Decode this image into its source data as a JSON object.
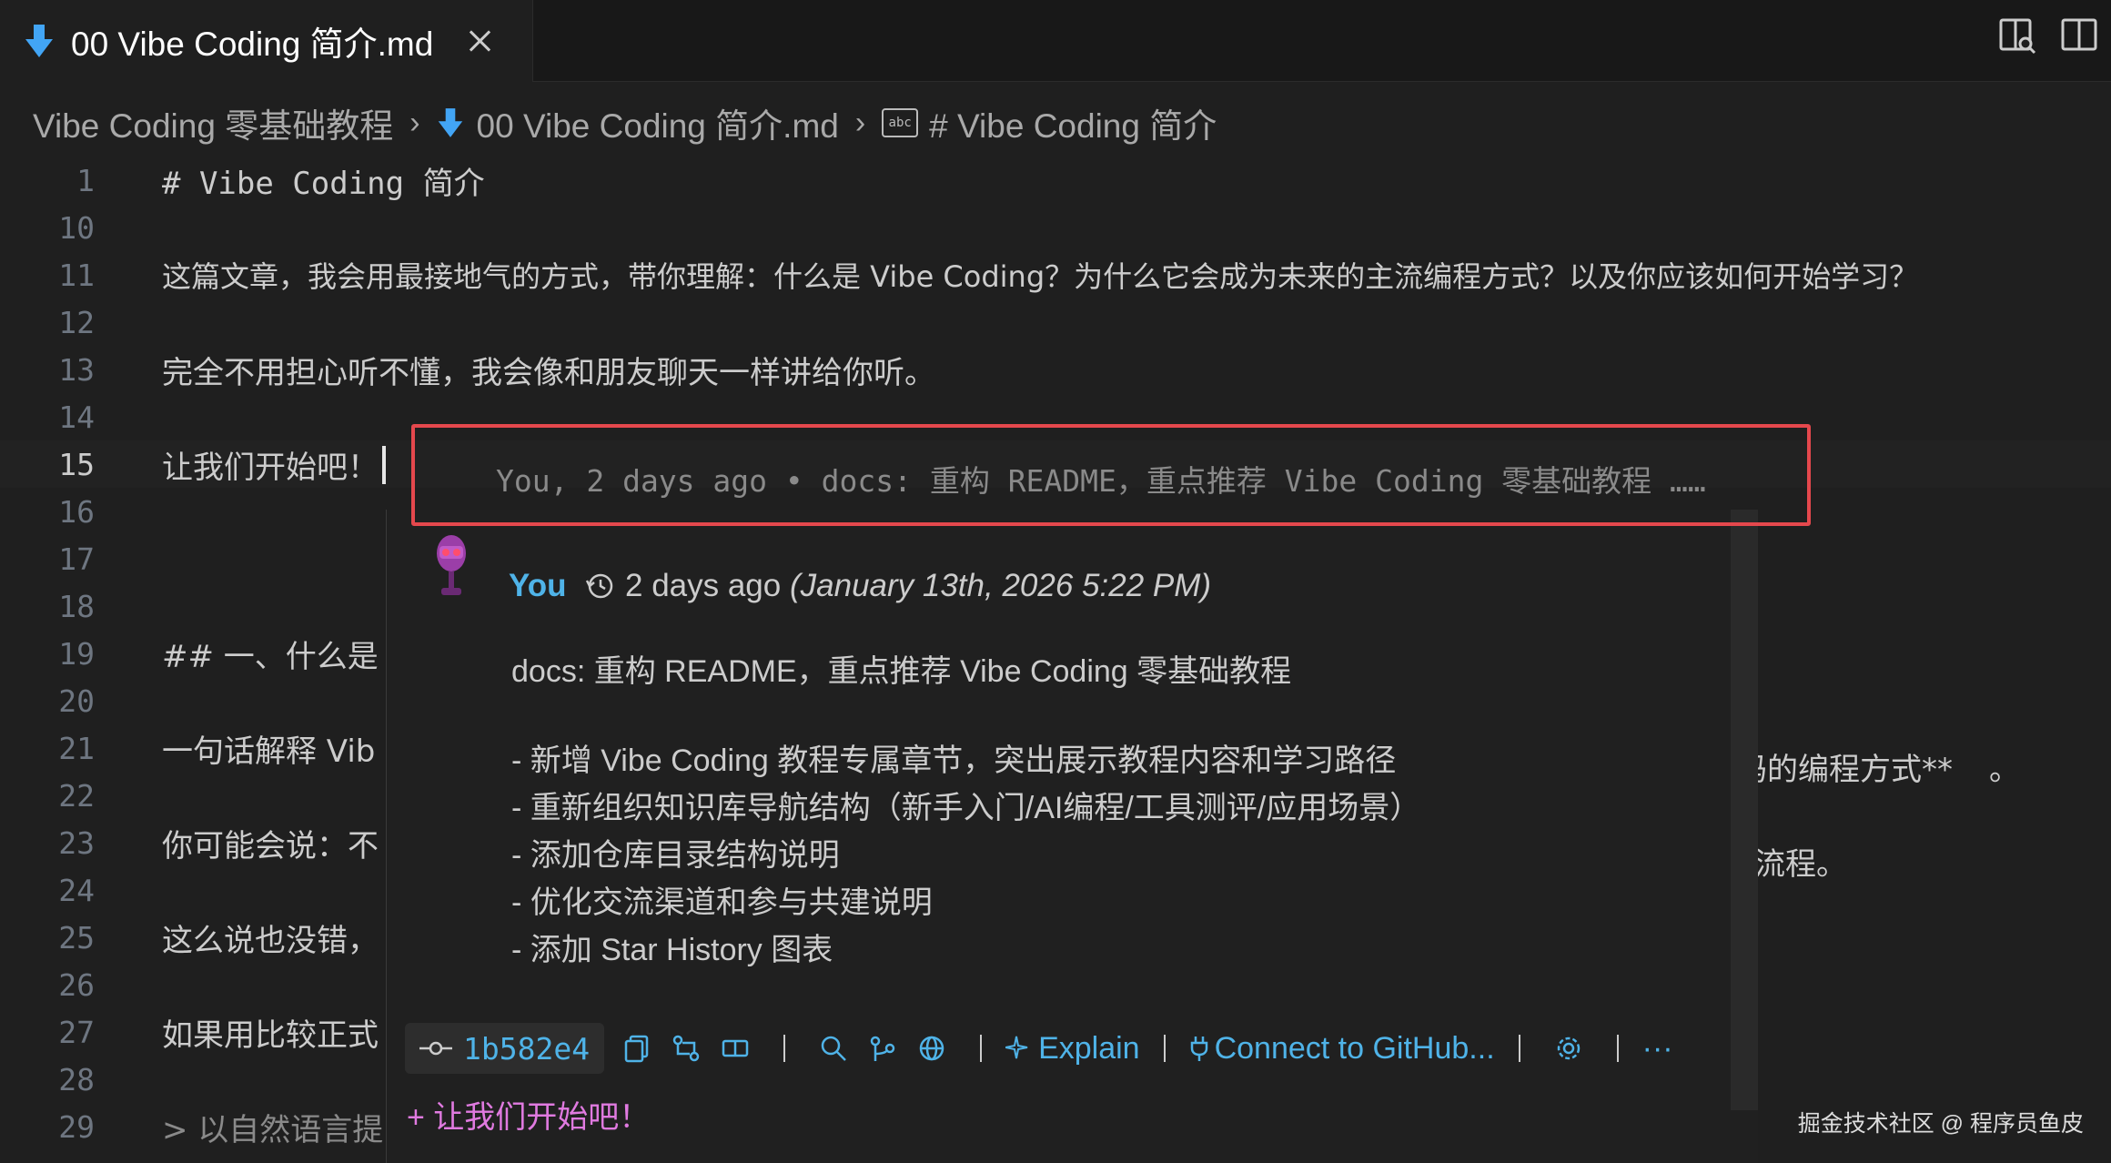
{
  "tab": {
    "title": "00 Vibe Coding 简介.md"
  },
  "breadcrumb": {
    "folder": "Vibe Coding 零基础教程",
    "file": "00 Vibe Coding 简介.md",
    "symbol": "# Vibe Coding 简介",
    "symbol_icon_text": "abc"
  },
  "lines": [
    {
      "n": "1",
      "text": "# Vibe Coding 简介"
    },
    {
      "n": "10",
      "text": ""
    },
    {
      "n": "11",
      "text": "这篇文章，我会用最接地气的方式，带你理解：什么是 Vibe Coding？为什么它会成为未来的主流编程方式？以及你应该如何开始学习？"
    },
    {
      "n": "12",
      "text": ""
    },
    {
      "n": "13",
      "text": "完全不用担心听不懂，我会像和朋友聊天一样讲给你听。"
    },
    {
      "n": "14",
      "text": ""
    },
    {
      "n": "15",
      "text": "让我们开始吧！"
    },
    {
      "n": "16",
      "text": ""
    },
    {
      "n": "17",
      "text": ""
    },
    {
      "n": "18",
      "text": ""
    },
    {
      "n": "19",
      "text": "## 一、什么是"
    },
    {
      "n": "20",
      "text": ""
    },
    {
      "n": "21",
      "text": "一句话解释 Vib"
    },
    {
      "n": "22",
      "text": ""
    },
    {
      "n": "23",
      "text": "你可能会说：不"
    },
    {
      "n": "24",
      "text": ""
    },
    {
      "n": "25",
      "text": "这么说也没错，"
    },
    {
      "n": "26",
      "text": ""
    },
    {
      "n": "27",
      "text": "如果用比较正式"
    },
    {
      "n": "28",
      "text": ""
    },
    {
      "n": "29",
      "text": "> 以自然语言提"
    }
  ],
  "tails": {
    "line21": "码的编程方式**",
    "line21_end": "。",
    "line25": "流程。"
  },
  "blame_inline": "You, 2 days ago • docs: 重构 README，重点推荐 Vibe Coding 零基础教程 ……",
  "popup": {
    "author": "You",
    "relative_time": "2 days ago",
    "absolute_time": "(January 13th, 2026 5:22 PM)",
    "message_title": "docs: 重构 README，重点推荐 Vibe Coding 零基础教程",
    "bullets": [
      "- 新增 Vibe Coding 教程专属章节，突出展示教程内容和学习路径",
      "- 重新组织知识库导航结构（新手入门/AI编程/工具测评/应用场景）",
      "- 添加仓库目录结构说明",
      "- 优化交流渠道和参与共建说明",
      "- 添加 Star History 图表"
    ],
    "sha": "1b582e4",
    "explain_label": "Explain",
    "connect_label": "Connect to GitHub...",
    "more_label": "···",
    "added_line": "+ 让我们开始吧！"
  },
  "watermark": "掘金技术社区 @ 程序员鱼皮",
  "colors": {
    "accent_blue": "#4fb3e8",
    "highlight_box": "#e5484d",
    "added_line": "#e07ae0",
    "markdown_bold": "#e5a94a"
  }
}
